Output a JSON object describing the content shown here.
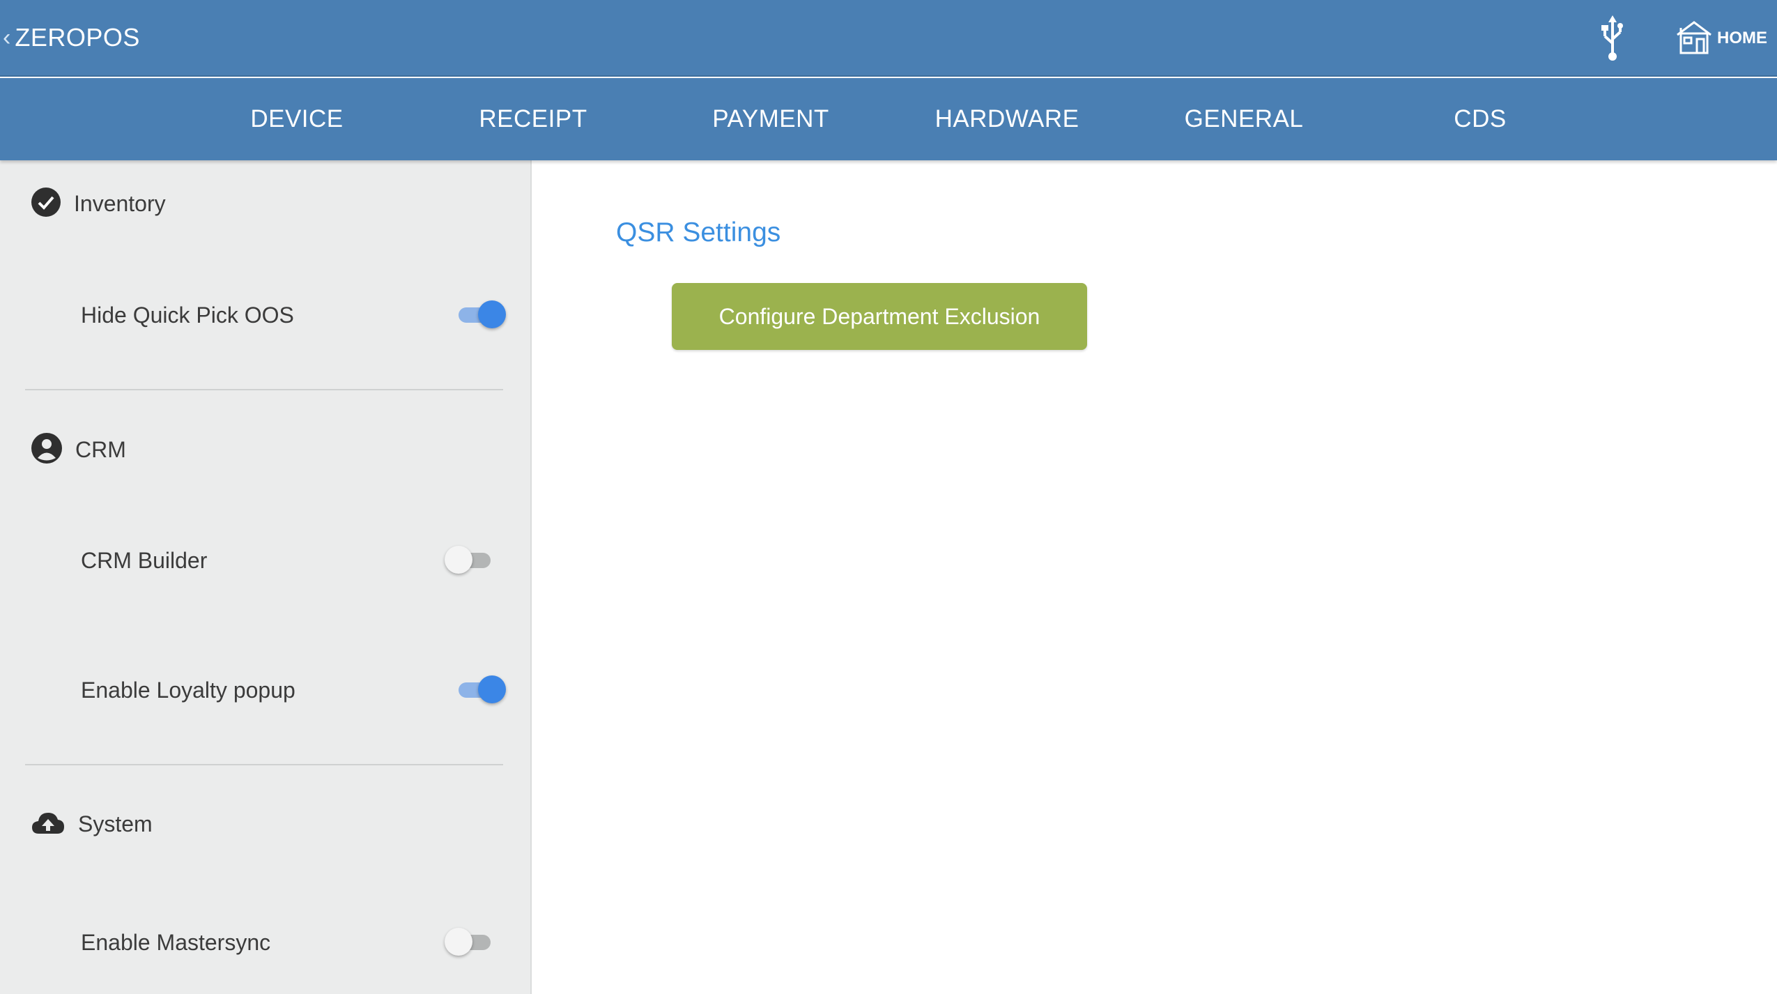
{
  "appbar": {
    "back_chevron": "‹",
    "title": "ZEROPOS",
    "usb_icon": "usb-icon",
    "home_label": "HOME",
    "color": "#4a7fb3"
  },
  "tabs": [
    {
      "label": "DEVICE"
    },
    {
      "label": "RECEIPT"
    },
    {
      "label": "PAYMENT"
    },
    {
      "label": "HARDWARE"
    },
    {
      "label": "GENERAL"
    },
    {
      "label": "CDS"
    }
  ],
  "panel": {
    "sections": [
      {
        "icon": "check-circle-icon",
        "title": "Inventory",
        "settings": [
          {
            "label": "Hide Quick Pick OOS",
            "enabled": true
          }
        ]
      },
      {
        "icon": "account-circle-icon",
        "title": "CRM",
        "settings": [
          {
            "label": "CRM Builder",
            "enabled": false
          },
          {
            "label": "Enable Loyalty popup",
            "enabled": true
          }
        ]
      },
      {
        "icon": "cloud-upload-icon",
        "title": "System",
        "settings": [
          {
            "label": "Enable Mastersync",
            "enabled": false
          }
        ]
      }
    ]
  },
  "main": {
    "title": "QSR Settings",
    "button_label": "Configure Department Exclusion",
    "button_color": "#9bb24e",
    "title_color": "#3b8fe0"
  }
}
